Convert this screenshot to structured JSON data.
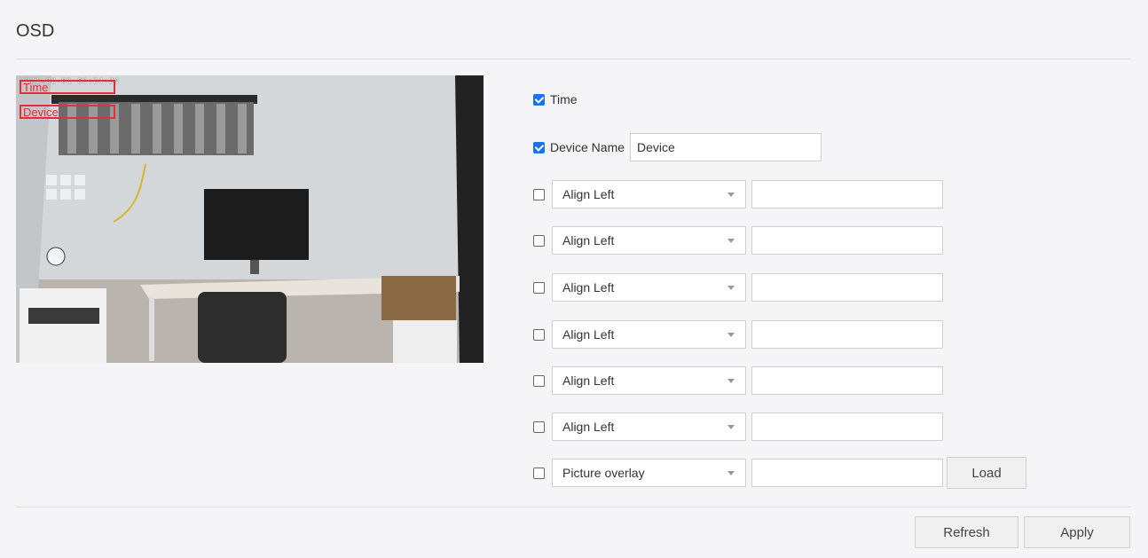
{
  "page": {
    "title": "OSD"
  },
  "preview": {
    "timestamp": "2021-02-01 03:24:24",
    "osd_time_label": "Time",
    "osd_device_label": "Device"
  },
  "osd": {
    "time": {
      "checked": true,
      "label": "Time"
    },
    "device_name": {
      "checked": true,
      "label": "Device Name",
      "value": "Device"
    },
    "custom_rows": [
      {
        "checked": false,
        "align": "Align Left",
        "value": ""
      },
      {
        "checked": false,
        "align": "Align Left",
        "value": ""
      },
      {
        "checked": false,
        "align": "Align Left",
        "value": ""
      },
      {
        "checked": false,
        "align": "Align Left",
        "value": ""
      },
      {
        "checked": false,
        "align": "Align Left",
        "value": ""
      },
      {
        "checked": false,
        "align": "Align Left",
        "value": ""
      }
    ],
    "picture_overlay": {
      "checked": false,
      "type": "Picture overlay",
      "value": "",
      "load_label": "Load"
    }
  },
  "footer": {
    "refresh_label": "Refresh",
    "apply_label": "Apply"
  },
  "colors": {
    "checkbox_accent": "#1a73e8",
    "osd_box": "#e0303a"
  }
}
